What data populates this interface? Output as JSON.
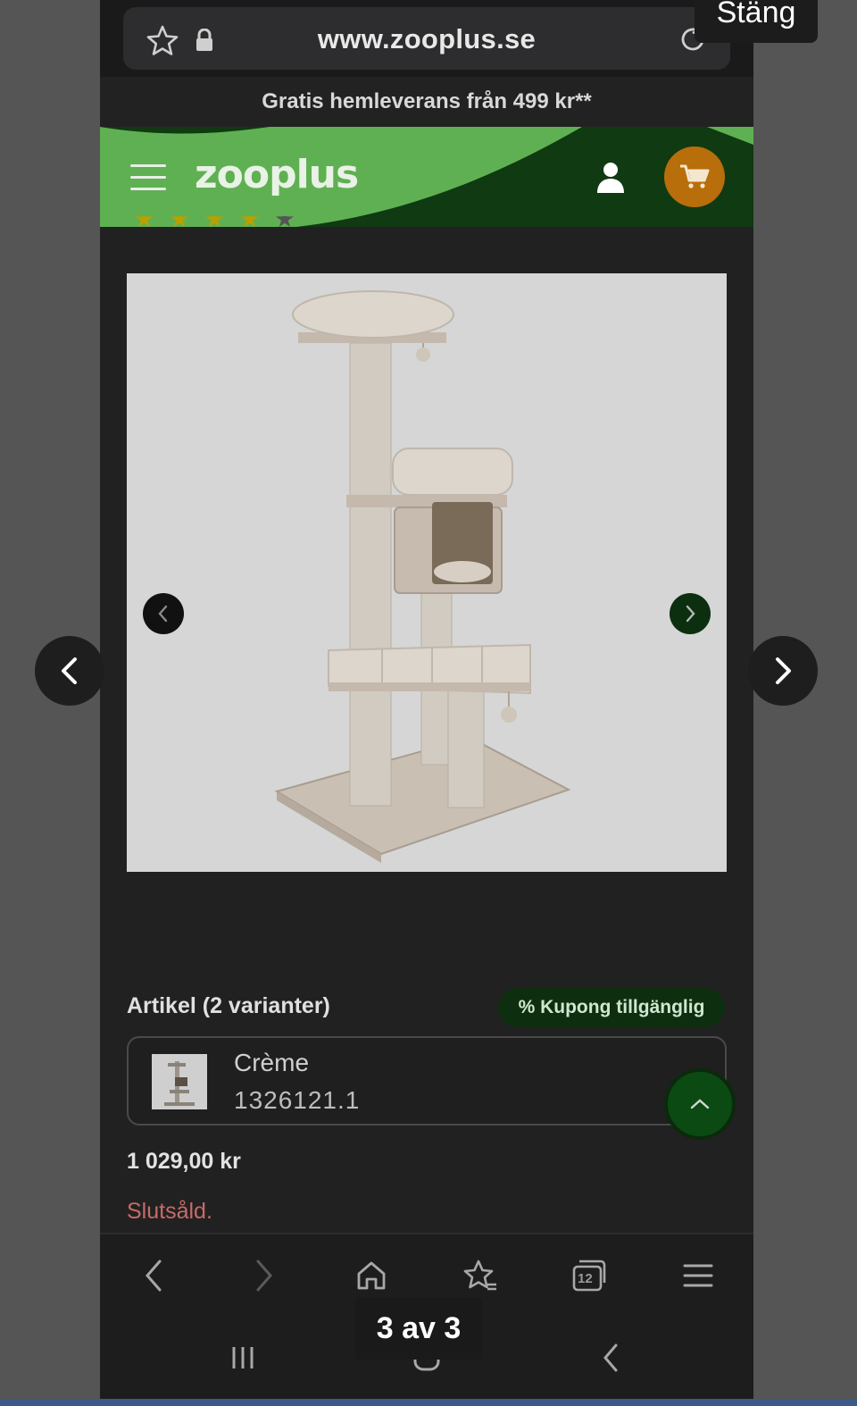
{
  "viewer": {
    "close_label": "Stäng",
    "page_counter": "3 av 3",
    "prev_icon": "chevron-left-icon",
    "next_icon": "chevron-right-icon"
  },
  "browser": {
    "url": "www.zooplus.se",
    "icons": [
      "star-icon",
      "lock-icon",
      "reload-icon"
    ],
    "toolbar": {
      "icons": [
        "back-icon",
        "forward-icon",
        "home-icon",
        "bookmark-star-icon",
        "tabs-icon",
        "menu-icon"
      ],
      "tab_count": "12"
    }
  },
  "site": {
    "promo": "Gratis hemleverans från 499 kr**",
    "logo": "zooplus",
    "colors": {
      "brand_green": "#5fb052",
      "dark_green": "#0f3a12",
      "cart_orange": "#b86e0a"
    }
  },
  "product": {
    "variant_heading": "Artikel (2 varianter)",
    "coupon": "% Kupong tillgänglig",
    "variant": {
      "name": "Crème",
      "code": "1326121.1"
    },
    "price": "1 029,00 kr",
    "status": "Slutsåld."
  },
  "system_nav": {
    "icons": [
      "recent-apps-icon",
      "home-icon",
      "back-icon"
    ]
  }
}
